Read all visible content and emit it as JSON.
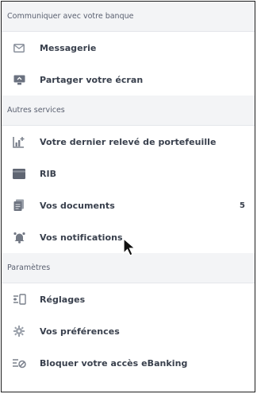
{
  "sections": [
    {
      "title": "Communiquer avec votre banque",
      "items": [
        {
          "label": "Messagerie",
          "icon": "mail-icon"
        },
        {
          "label": "Partager votre écran",
          "icon": "screen-share-icon"
        }
      ]
    },
    {
      "title": "Autres services",
      "items": [
        {
          "label": "Votre dernier relevé de portefeuille",
          "icon": "portfolio-chart-icon"
        },
        {
          "label": "RIB",
          "icon": "bank-card-icon"
        },
        {
          "label": "Vos documents",
          "icon": "documents-icon",
          "count": "5"
        },
        {
          "label": "Vos notifications",
          "icon": "bell-icon"
        }
      ]
    },
    {
      "title": "Paramètres",
      "items": [
        {
          "label": "Réglages",
          "icon": "settings-sliders-icon"
        },
        {
          "label": "Vos préférences",
          "icon": "gear-icon"
        },
        {
          "label": "Bloquer votre accès eBanking",
          "icon": "lock-access-icon"
        }
      ]
    }
  ]
}
